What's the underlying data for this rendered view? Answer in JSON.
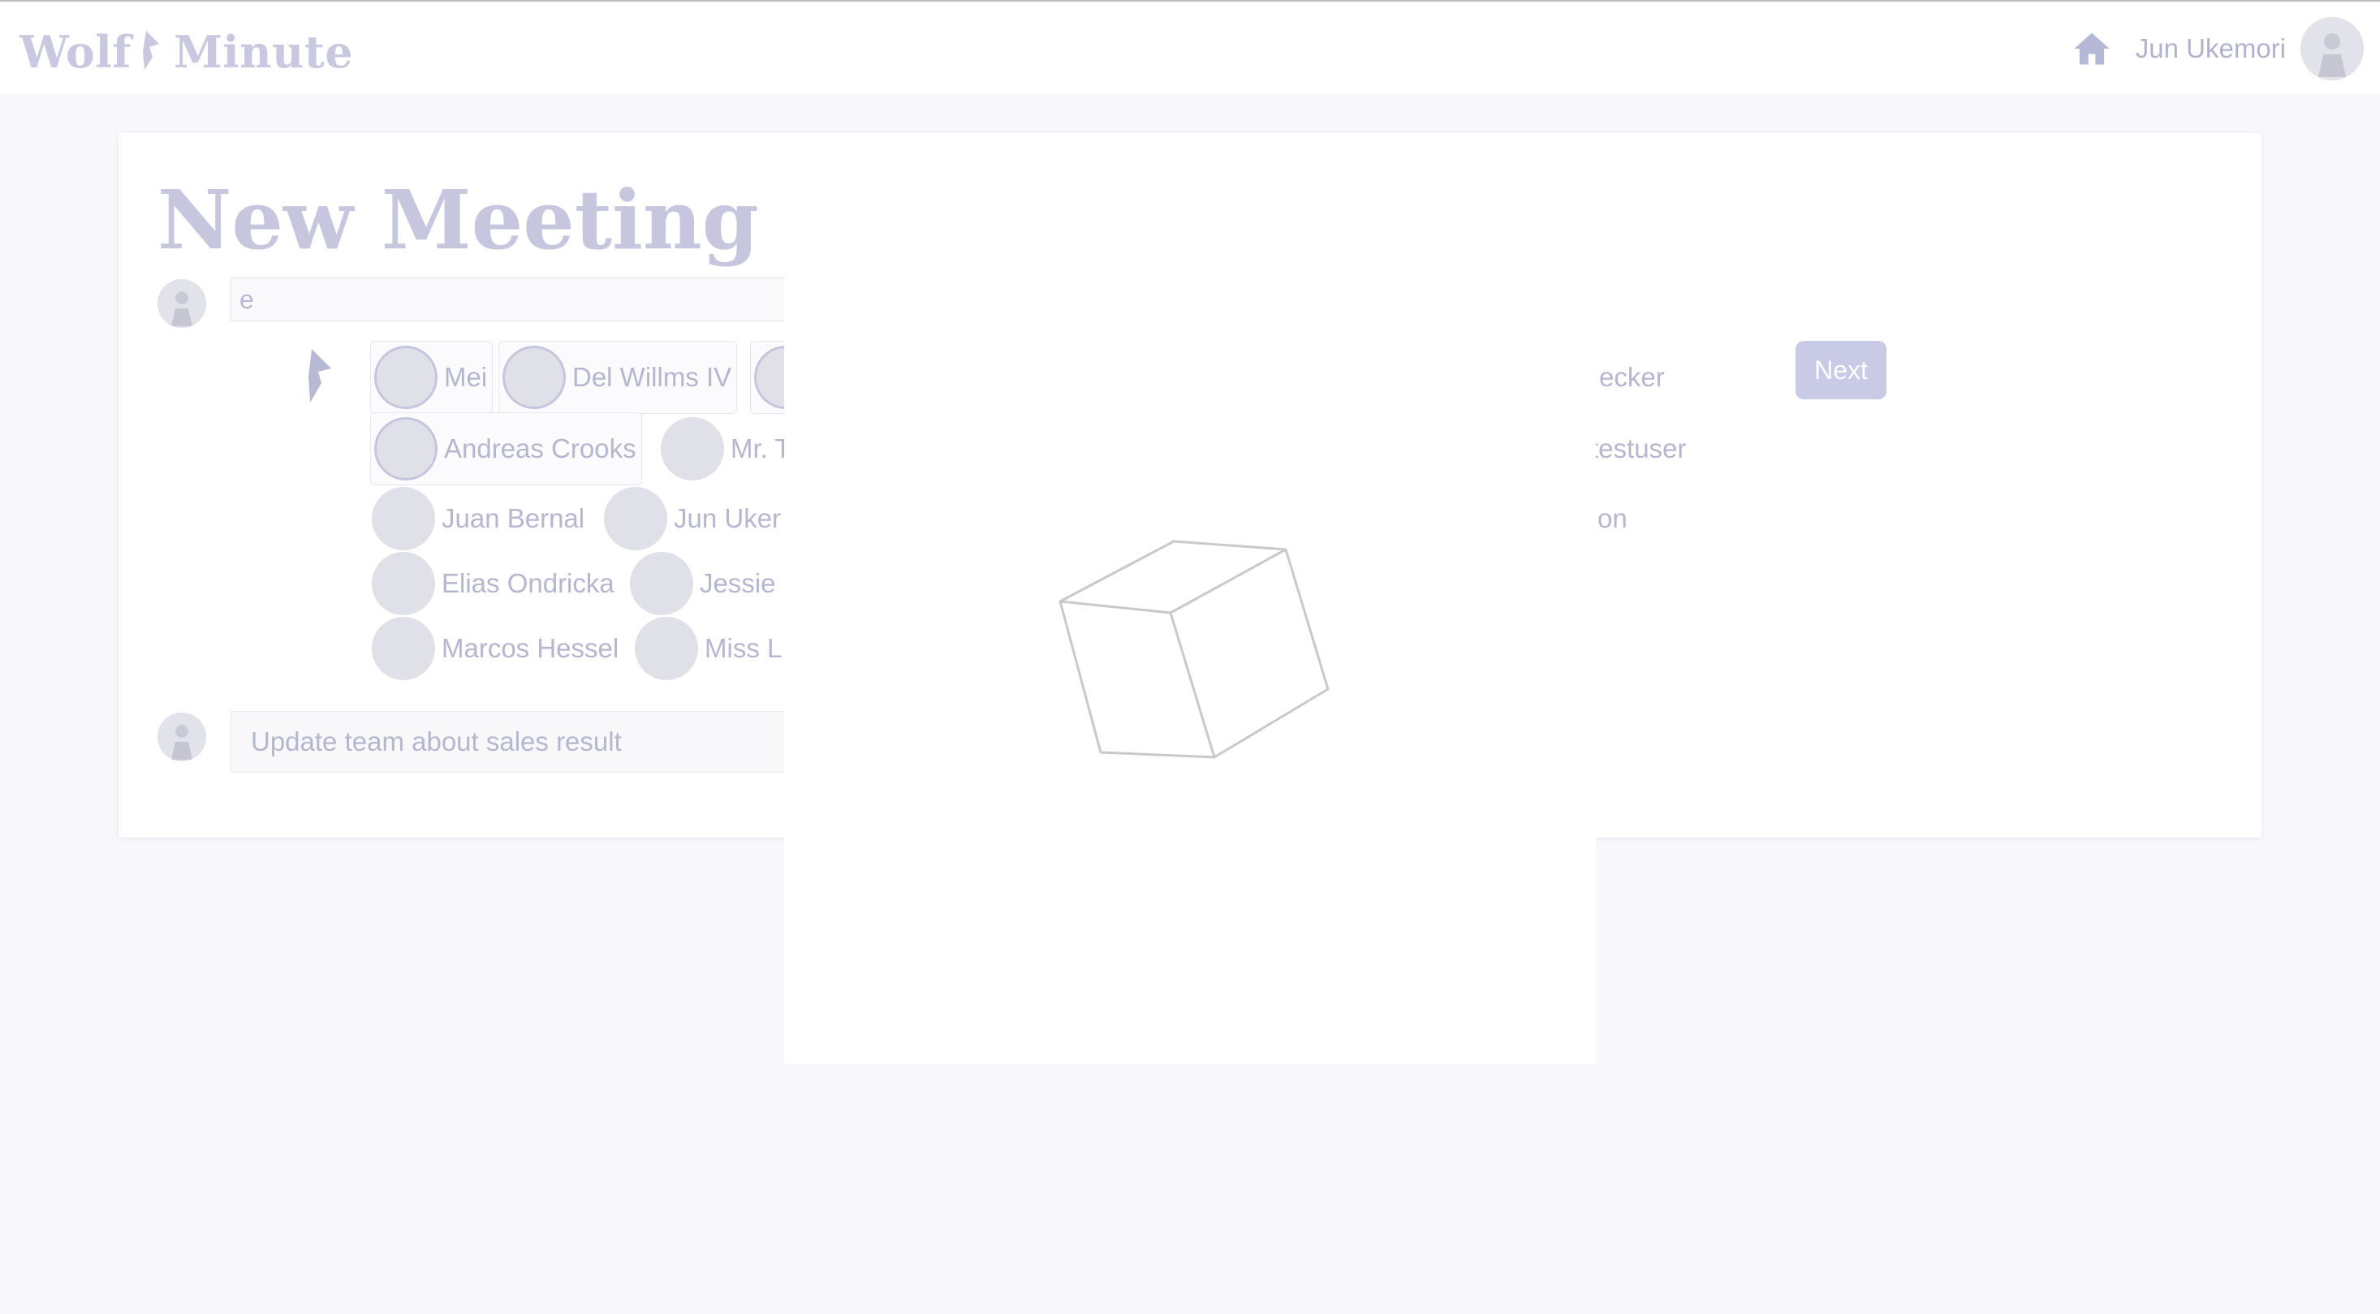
{
  "header": {
    "brand_left": "Wolf",
    "brand_right": "Minute",
    "user_name": "Jun Ukemori"
  },
  "page": {
    "title": "New Meeting",
    "search_value": "e",
    "agenda_value": "Update team about sales result",
    "next_label": "Next"
  },
  "people": {
    "row1": [
      "Mei",
      "Del Willms IV",
      "ecker"
    ],
    "row2": [
      "Andreas Crooks",
      "Mr. T",
      "testuser"
    ],
    "row3": [
      "Juan Bernal",
      "Jun Uker",
      "on"
    ],
    "row4": [
      "Elias Ondricka",
      "Jessie"
    ],
    "row5": [
      "Marcos Hessel",
      "Miss L"
    ]
  },
  "colors": {
    "accent": "#c9cae6",
    "brand": "#c8c9e0",
    "text_muted": "#b5b6d0"
  },
  "icons": {
    "home": "home-icon",
    "loading": "cube-loader-icon",
    "logo": "wolf-logo-icon"
  }
}
